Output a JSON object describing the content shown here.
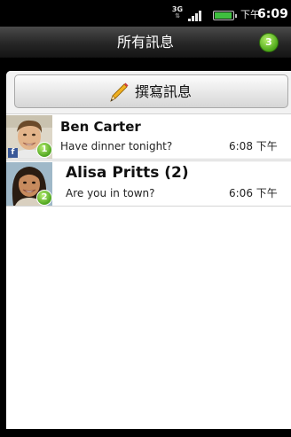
{
  "status_bar": {
    "network": "3G",
    "network_arrows": "⇅",
    "ampm": "下午",
    "time": "6:09",
    "icons": [
      "3g-icon",
      "signal-icon",
      "battery-icon"
    ]
  },
  "header": {
    "title": "所有訊息",
    "badge": "3"
  },
  "compose": {
    "label": "撰寫訊息",
    "icon": "pencil-icon"
  },
  "threads": [
    {
      "name": "Ben Carter",
      "snippet": "Have dinner tonight?",
      "time": "6:08 下午",
      "unread": "1",
      "source_icon": "f"
    },
    {
      "name": "Alisa Pritts (2)",
      "snippet": "Are you in town?",
      "time": "6:06 下午",
      "unread": "2"
    }
  ],
  "colors": {
    "badge_green": "#4ea81a",
    "facebook_blue": "#3b5998"
  }
}
